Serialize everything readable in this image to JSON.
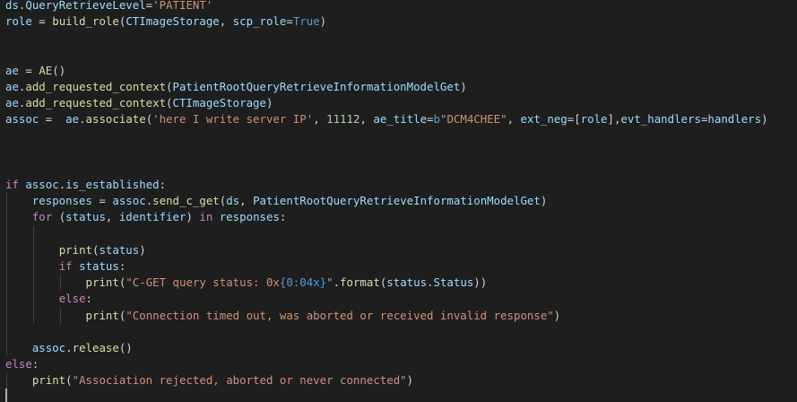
{
  "editor": {
    "lines": [
      [
        {
          "t": "ds",
          "c": "var"
        },
        {
          "t": ".",
          "c": "plain"
        },
        {
          "t": "QueryRetrieveLevel",
          "c": "var"
        },
        {
          "t": "=",
          "c": "plain"
        },
        {
          "t": "'PATIENT'",
          "c": "str"
        }
      ],
      [
        {
          "t": "role",
          "c": "var"
        },
        {
          "t": " = ",
          "c": "plain"
        },
        {
          "t": "build_role",
          "c": "fn"
        },
        {
          "t": "(",
          "c": "plain"
        },
        {
          "t": "CTImageStorage",
          "c": "var"
        },
        {
          "t": ", ",
          "c": "plain"
        },
        {
          "t": "scp_role",
          "c": "var"
        },
        {
          "t": "=",
          "c": "plain"
        },
        {
          "t": "True",
          "c": "const"
        },
        {
          "t": ")",
          "c": "plain"
        }
      ],
      [],
      [],
      [
        {
          "t": "ae",
          "c": "var"
        },
        {
          "t": " = ",
          "c": "plain"
        },
        {
          "t": "AE",
          "c": "fn"
        },
        {
          "t": "()",
          "c": "plain"
        }
      ],
      [
        {
          "t": "ae",
          "c": "var"
        },
        {
          "t": ".",
          "c": "plain"
        },
        {
          "t": "add_requested_context",
          "c": "fn"
        },
        {
          "t": "(",
          "c": "plain"
        },
        {
          "t": "PatientRootQueryRetrieveInformationModelGet",
          "c": "var"
        },
        {
          "t": ")",
          "c": "plain"
        }
      ],
      [
        {
          "t": "ae",
          "c": "var"
        },
        {
          "t": ".",
          "c": "plain"
        },
        {
          "t": "add_requested_context",
          "c": "fn"
        },
        {
          "t": "(",
          "c": "plain"
        },
        {
          "t": "CTImageStorage",
          "c": "var"
        },
        {
          "t": ")",
          "c": "plain"
        }
      ],
      [
        {
          "t": "assoc",
          "c": "var"
        },
        {
          "t": " =  ",
          "c": "plain"
        },
        {
          "t": "ae",
          "c": "var"
        },
        {
          "t": ".",
          "c": "plain"
        },
        {
          "t": "associate",
          "c": "fn"
        },
        {
          "t": "(",
          "c": "plain"
        },
        {
          "t": "'here I write server IP'",
          "c": "str"
        },
        {
          "t": ", ",
          "c": "plain"
        },
        {
          "t": "11112",
          "c": "num"
        },
        {
          "t": ", ",
          "c": "plain"
        },
        {
          "t": "ae_title",
          "c": "var"
        },
        {
          "t": "=",
          "c": "plain"
        },
        {
          "t": "b",
          "c": "const"
        },
        {
          "t": "\"DCM4CHEE\"",
          "c": "str"
        },
        {
          "t": ", ",
          "c": "plain"
        },
        {
          "t": "ext_neg",
          "c": "var"
        },
        {
          "t": "=[",
          "c": "plain"
        },
        {
          "t": "role",
          "c": "var"
        },
        {
          "t": "],",
          "c": "plain"
        },
        {
          "t": "evt_handlers",
          "c": "var"
        },
        {
          "t": "=",
          "c": "plain"
        },
        {
          "t": "handlers",
          "c": "var"
        },
        {
          "t": ")",
          "c": "plain"
        }
      ],
      [],
      [],
      [],
      [
        {
          "t": "if",
          "c": "kw"
        },
        {
          "t": " ",
          "c": "plain"
        },
        {
          "t": "assoc",
          "c": "var"
        },
        {
          "t": ".",
          "c": "plain"
        },
        {
          "t": "is_established",
          "c": "var"
        },
        {
          "t": ":",
          "c": "plain"
        }
      ],
      [
        {
          "t": "    ",
          "c": "plain"
        },
        {
          "t": "responses",
          "c": "var"
        },
        {
          "t": " = ",
          "c": "plain"
        },
        {
          "t": "assoc",
          "c": "var"
        },
        {
          "t": ".",
          "c": "plain"
        },
        {
          "t": "send_c_get",
          "c": "fn"
        },
        {
          "t": "(",
          "c": "plain"
        },
        {
          "t": "ds",
          "c": "var"
        },
        {
          "t": ", ",
          "c": "plain"
        },
        {
          "t": "PatientRootQueryRetrieveInformationModelGet",
          "c": "var"
        },
        {
          "t": ")",
          "c": "plain"
        }
      ],
      [
        {
          "t": "    ",
          "c": "plain"
        },
        {
          "t": "for",
          "c": "kw"
        },
        {
          "t": " (",
          "c": "plain"
        },
        {
          "t": "status",
          "c": "var"
        },
        {
          "t": ", ",
          "c": "plain"
        },
        {
          "t": "identifier",
          "c": "var"
        },
        {
          "t": ") ",
          "c": "plain"
        },
        {
          "t": "in",
          "c": "kw"
        },
        {
          "t": " ",
          "c": "plain"
        },
        {
          "t": "responses",
          "c": "var"
        },
        {
          "t": ":",
          "c": "plain"
        }
      ],
      [],
      [
        {
          "t": "        ",
          "c": "plain"
        },
        {
          "t": "print",
          "c": "fn"
        },
        {
          "t": "(",
          "c": "plain"
        },
        {
          "t": "status",
          "c": "var"
        },
        {
          "t": ")",
          "c": "plain"
        }
      ],
      [
        {
          "t": "        ",
          "c": "plain"
        },
        {
          "t": "if",
          "c": "kw"
        },
        {
          "t": " ",
          "c": "plain"
        },
        {
          "t": "status",
          "c": "var"
        },
        {
          "t": ":",
          "c": "plain"
        }
      ],
      [
        {
          "t": "            ",
          "c": "plain"
        },
        {
          "t": "print",
          "c": "fn"
        },
        {
          "t": "(",
          "c": "plain"
        },
        {
          "t": "\"C-GET query status: 0x",
          "c": "str"
        },
        {
          "t": "{0:04x}",
          "c": "const"
        },
        {
          "t": "\"",
          "c": "str"
        },
        {
          "t": ".",
          "c": "plain"
        },
        {
          "t": "format",
          "c": "fn"
        },
        {
          "t": "(",
          "c": "plain"
        },
        {
          "t": "status",
          "c": "var"
        },
        {
          "t": ".",
          "c": "plain"
        },
        {
          "t": "Status",
          "c": "var"
        },
        {
          "t": "))",
          "c": "plain"
        }
      ],
      [
        {
          "t": "        ",
          "c": "plain"
        },
        {
          "t": "else",
          "c": "kw"
        },
        {
          "t": ":",
          "c": "plain"
        }
      ],
      [
        {
          "t": "            ",
          "c": "plain"
        },
        {
          "t": "print",
          "c": "fn"
        },
        {
          "t": "(",
          "c": "plain"
        },
        {
          "t": "\"Connection timed out, was aborted or received invalid response\"",
          "c": "str"
        },
        {
          "t": ")",
          "c": "plain"
        }
      ],
      [],
      [
        {
          "t": "    ",
          "c": "plain"
        },
        {
          "t": "assoc",
          "c": "var"
        },
        {
          "t": ".",
          "c": "plain"
        },
        {
          "t": "release",
          "c": "fn"
        },
        {
          "t": "()",
          "c": "plain"
        }
      ],
      [
        {
          "t": "else",
          "c": "kw"
        },
        {
          "t": ":",
          "c": "plain"
        }
      ],
      [
        {
          "t": "    ",
          "c": "plain"
        },
        {
          "t": "print",
          "c": "fn"
        },
        {
          "t": "(",
          "c": "plain"
        },
        {
          "t": "\"Association rejected, aborted or never connected\"",
          "c": "str"
        },
        {
          "t": ")",
          "c": "plain"
        }
      ],
      []
    ]
  }
}
